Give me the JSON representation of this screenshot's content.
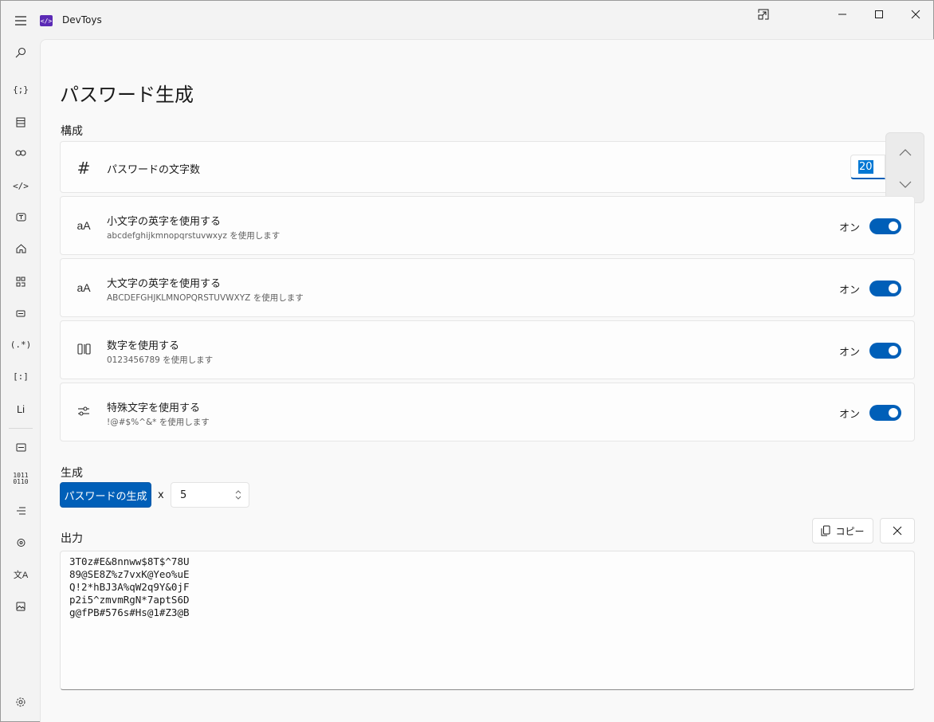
{
  "app": {
    "title": "DevToys",
    "logo_glyph": "</>"
  },
  "nav": {
    "items": [
      {
        "name": "search-icon",
        "glyph": "⌕"
      },
      {
        "name": "converters-icon",
        "glyph": "{;}"
      },
      {
        "name": "encoders-icon",
        "glyph": "▤"
      },
      {
        "name": "link-icon",
        "glyph": "⊖"
      },
      {
        "name": "code-icon",
        "glyph": "</>"
      },
      {
        "name": "text-icon",
        "glyph": "T"
      },
      {
        "name": "home-icon",
        "glyph": "⌂"
      },
      {
        "name": "generators-icon",
        "glyph": "⧉"
      },
      {
        "name": "card-icon",
        "glyph": "▭"
      },
      {
        "name": "regex-icon",
        "glyph": "(.*)"
      },
      {
        "name": "bracket-icon",
        "glyph": "[:]"
      },
      {
        "name": "lorem-icon",
        "glyph": "Li"
      },
      {
        "name": "format-icon",
        "glyph": "⊟"
      },
      {
        "name": "binary-icon",
        "glyph": "1011"
      },
      {
        "name": "list-icon",
        "glyph": "≔"
      },
      {
        "name": "hash-icon",
        "glyph": "⊛"
      },
      {
        "name": "translate-icon",
        "glyph": "文A"
      },
      {
        "name": "image-icon",
        "glyph": "▣"
      },
      {
        "name": "settings-icon",
        "glyph": "⚙"
      }
    ]
  },
  "page": {
    "title": "パスワード生成",
    "config_label": "構成",
    "generate_label": "生成",
    "output_label": "出力"
  },
  "length": {
    "label": "パスワードの文字数",
    "value": "20",
    "icon": "#"
  },
  "options": [
    {
      "icon": "aA",
      "title": "小文字の英字を使用する",
      "desc": "abcdefghijkmnopqrstuvwxyz を使用します",
      "state": "オン"
    },
    {
      "icon": "aA",
      "title": "大文字の英字を使用する",
      "desc": "ABCDEFGHJKLMNOPQRSTUVWXYZ を使用します",
      "state": "オン"
    },
    {
      "icon": "⁰⁹",
      "title": "数字を使用する",
      "desc": "0123456789 を使用します",
      "state": "オン"
    },
    {
      "icon": "⚌",
      "title": "特殊文字を使用する",
      "desc": "!@#$%^&* を使用します",
      "state": "オン"
    }
  ],
  "generate": {
    "button": "パスワードの生成",
    "x": "x",
    "count": "5"
  },
  "output": {
    "copy_label": "コピー",
    "lines": [
      "3T0z#E&8nnww$8T$^78U",
      "89@SE8Z%z7vxK@Yeo%uE",
      "Q!2*hBJ3A%qW2q9Y&0jF",
      "p2i5^zmvmRgN*7aptS6D",
      "g@fPB#576s#Hs@1#Z3@B"
    ]
  },
  "colors": {
    "accent": "#005fb8"
  }
}
